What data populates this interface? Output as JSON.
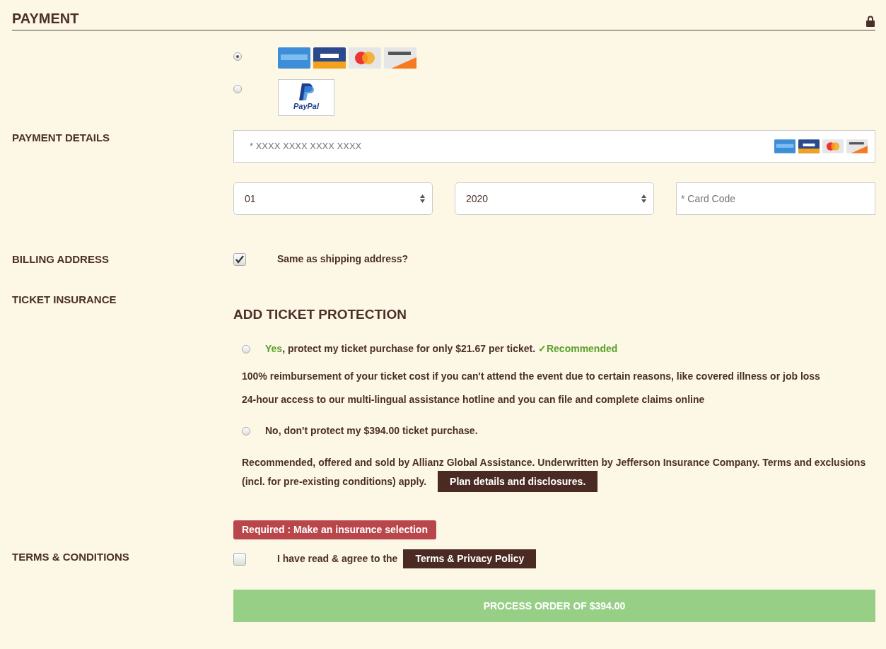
{
  "section": {
    "title": "PAYMENT"
  },
  "payment_methods": [
    {
      "kind": "cards",
      "selected": true
    },
    {
      "kind": "paypal",
      "selected": false,
      "label": "PayPal"
    }
  ],
  "payment_details": {
    "label": "PAYMENT DETAILS",
    "card_number": {
      "placeholder": "* XXXX XXXX XXXX XXXX"
    },
    "month": {
      "value": "01"
    },
    "year": {
      "value": "2020"
    },
    "card_code": {
      "placeholder": "* Card Code"
    }
  },
  "billing": {
    "label": "BILLING ADDRESS",
    "checked": true,
    "text": "Same as shipping address?"
  },
  "insurance": {
    "label": "TICKET INSURANCE",
    "heading": "ADD TICKET PROTECTION",
    "yes_option": {
      "selected": false,
      "lead": "Yes",
      "text": ", protect my ticket purchase for only $21.67 per ticket.",
      "badge": "✓Recommended"
    },
    "benefits": [
      "**100% reimbursement** of your ticket cost if you can't attend the event due to certain reasons, like covered illness or job loss",
      "24-hour access to our multi-lingual assistance hotline and you can file and complete claims online"
    ],
    "no_option": {
      "selected": false,
      "text": "No, don't protect my $394.00 ticket purchase."
    },
    "disclaimer": [
      "Recommended, offered and sold by Allianz Global Assistance. Underwritten by Jefferson Insurance Company. Terms and exclusions",
      "(incl. for pre-existing conditions) apply."
    ],
    "plan_button": "Plan details and disclosures.",
    "error": "Required : Make an insurance selection"
  },
  "terms": {
    "label": "TERMS & CONDITIONS",
    "checked": false,
    "text": "I have read & agree to the",
    "button": "Terms & Privacy Policy"
  },
  "submit": "PROCESS ORDER OF $394.00"
}
